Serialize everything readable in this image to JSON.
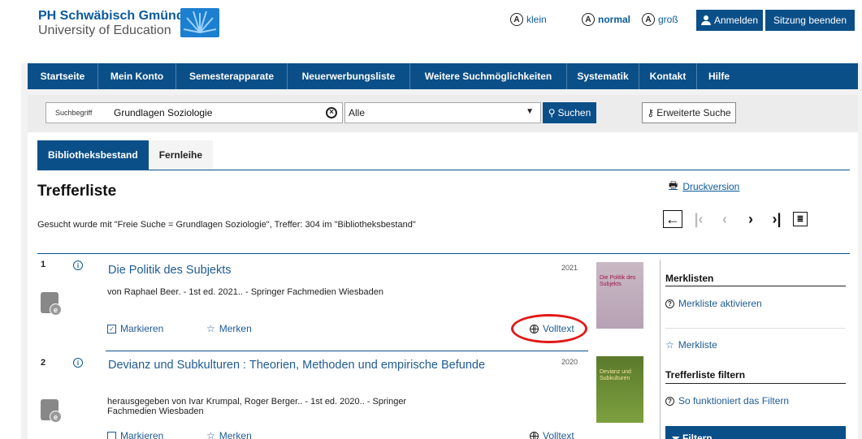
{
  "header": {
    "logo_line1": "PH Schwäbisch Gmünd",
    "logo_line2": "University of Education",
    "font_sizes": [
      {
        "letter": "A",
        "label": "klein"
      },
      {
        "letter": "A",
        "label": "normal"
      },
      {
        "letter": "A",
        "label": "groß"
      }
    ],
    "login_label": "Anmelden",
    "logout_label": "Sitzung beenden"
  },
  "nav": [
    "Startseite",
    "Mein Konto",
    "Semesterapparate",
    "Neuerwerbungsliste",
    "Weitere Suchmöglichkeiten",
    "Systematik",
    "Kontakt",
    "Hilfe"
  ],
  "search": {
    "label": "Suchbegriff",
    "value": "Grundlagen Soziologie",
    "scope": "Alle",
    "search_button": "Suchen",
    "advanced_button": "Erweiterte Suche"
  },
  "tabs": [
    "Bibliotheksbestand",
    "Fernleihe"
  ],
  "results_page": {
    "title": "Trefferliste",
    "summary": "Gesucht wurde mit \"Freie Suche = Grundlagen Soziologie\", Treffer: 304 im \"Bibliotheksbestand\"",
    "print_label": "Druckversion"
  },
  "results": [
    {
      "number": "1",
      "title": "Die Politik des Subjekts",
      "year": "2021",
      "author": "von Raphael Beer. - 1st ed. 2021.. - Springer Fachmedien Wiesbaden",
      "mark_label": "Markieren",
      "remember_label": "Merken",
      "fulltext_label": "Volltext",
      "cover_text": "Die Politik des Subjekts"
    },
    {
      "number": "2",
      "title": "Devianz und Subkulturen : Theorien, Methoden und empirische Befunde",
      "year": "2020",
      "author": "herausgegeben von Ivar Krumpal, Roger Berger.. - 1st ed. 2020.. - Springer Fachmedien Wiesbaden",
      "mark_label": "Markieren",
      "remember_label": "Merken",
      "fulltext_label": "Volltext",
      "cover_text": "Devianz und Subkulturen"
    }
  ],
  "sidebar": {
    "merklisten_heading": "Merklisten",
    "activate_label": "Merkliste aktivieren",
    "merkliste_label": "Merkliste",
    "filter_heading": "Trefferliste filtern",
    "filter_help": "So funktioniert das Filtern",
    "filter_button": "Filtern"
  },
  "colors": {
    "primary": "#0b4f88",
    "link": "#1f5b94",
    "highlight": "#e31818"
  }
}
